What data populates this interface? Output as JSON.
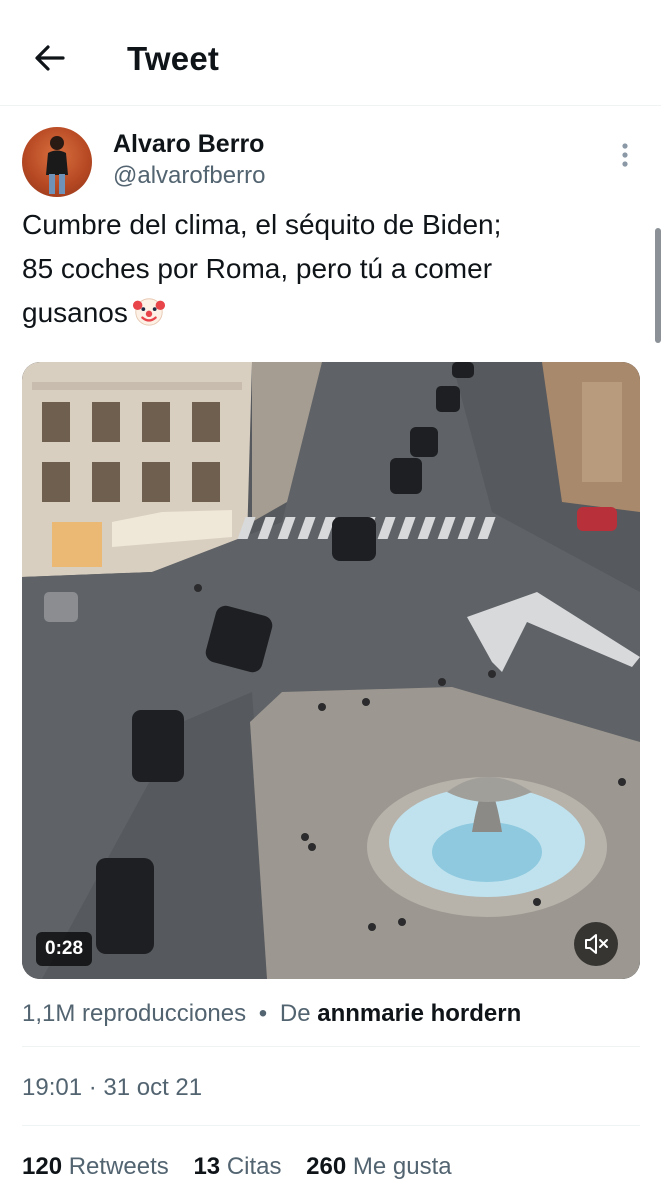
{
  "header": {
    "title": "Tweet"
  },
  "author": {
    "display_name": "Alvaro Berro",
    "handle": "@alvarofberro"
  },
  "tweet": {
    "text_lines": [
      "Cumbre del clima, el séquito de Biden;",
      "85 coches por Roma, pero tú a comer",
      "gusanos"
    ],
    "emoji": "clown-face"
  },
  "media": {
    "duration": "0:28"
  },
  "meta": {
    "views": "1,1M reproducciones",
    "separator": "•",
    "from_label": "De",
    "from_name": "annmarie hordern",
    "timestamp": "19:01 · 31 oct 21"
  },
  "stats": [
    {
      "count": "120",
      "label": "Retweets"
    },
    {
      "count": "13",
      "label": "Citas"
    },
    {
      "count": "260",
      "label": "Me gusta"
    }
  ],
  "icons": [
    "arrow-left-icon",
    "more-vertical-icon",
    "volume-muted-icon"
  ],
  "colors": {
    "text": "#0f1419",
    "secondary": "#536471",
    "divider": "#eff3f4"
  }
}
